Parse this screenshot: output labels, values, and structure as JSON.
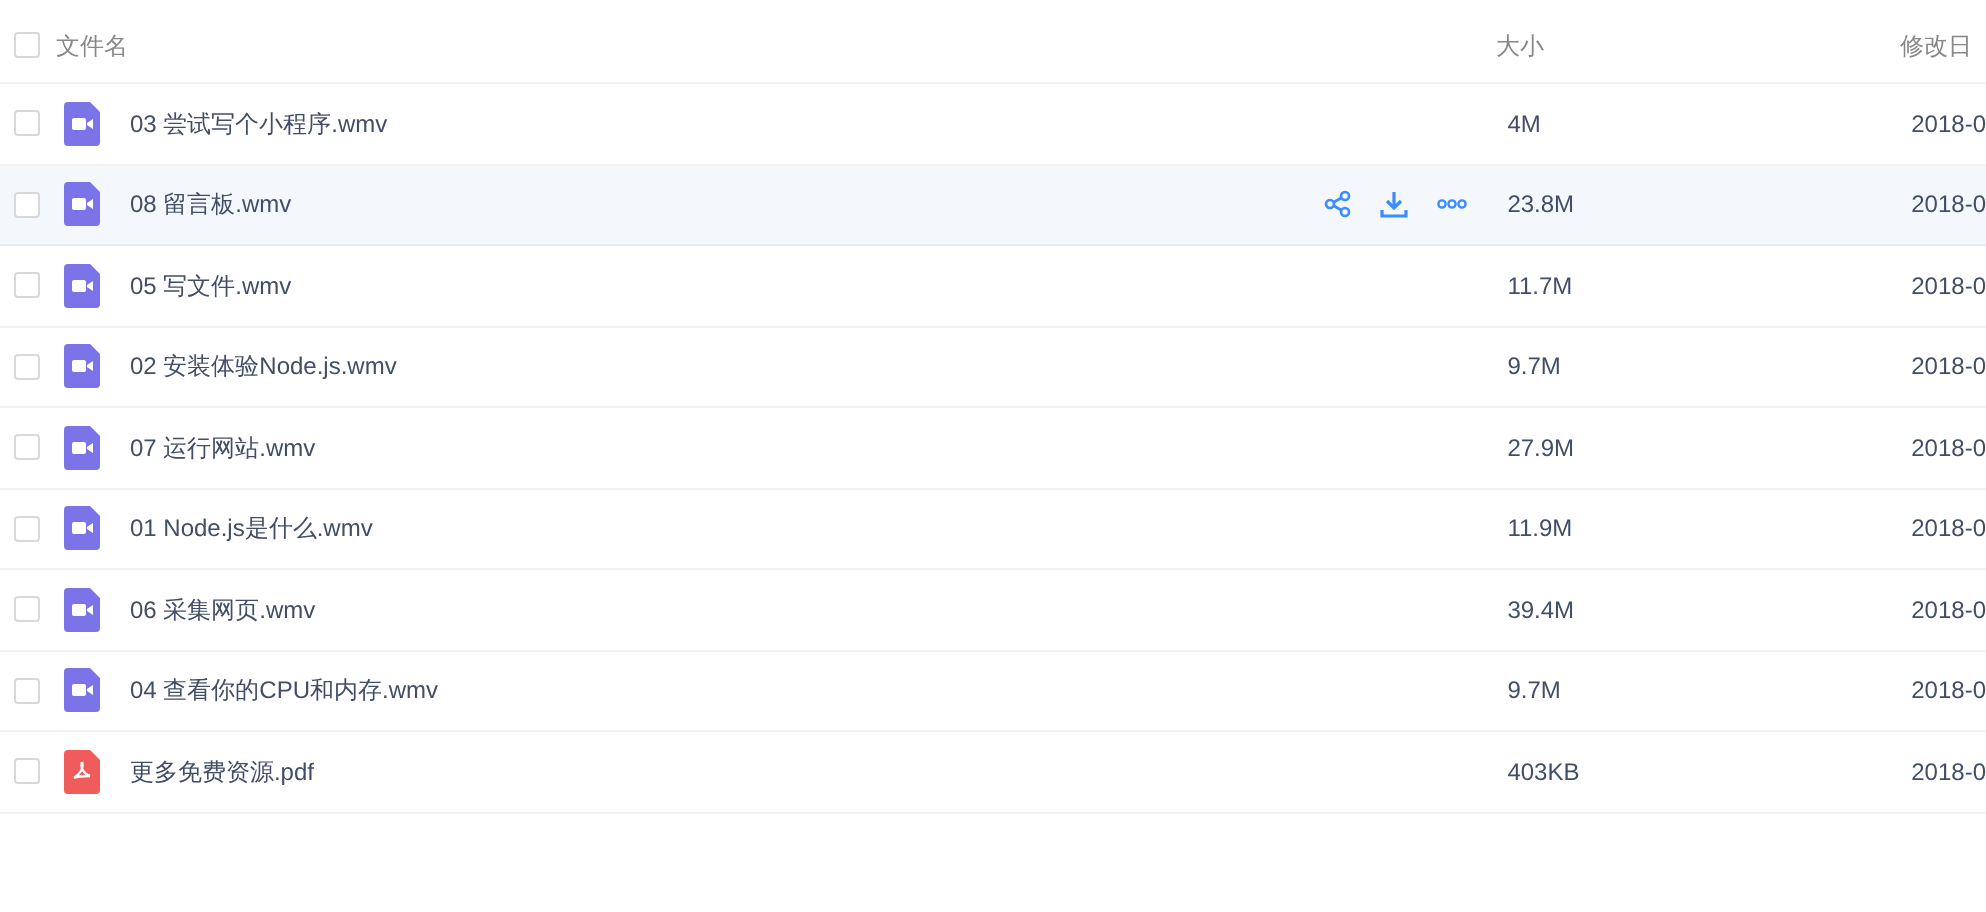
{
  "columns": {
    "name": "文件名",
    "size": "大小",
    "modified": "修改日"
  },
  "header_checked": false,
  "files": [
    {
      "kind": "video",
      "name": "03 尝试写个小程序.wmv",
      "size": "4M",
      "modified": "2018-0",
      "checked": false,
      "highlighted": false
    },
    {
      "kind": "video",
      "name": "08 留言板.wmv",
      "size": "23.8M",
      "modified": "2018-0",
      "checked": false,
      "highlighted": true
    },
    {
      "kind": "video",
      "name": "05 写文件.wmv",
      "size": "11.7M",
      "modified": "2018-0",
      "checked": false,
      "highlighted": false
    },
    {
      "kind": "video",
      "name": "02 安装体验Node.js.wmv",
      "size": "9.7M",
      "modified": "2018-0",
      "checked": false,
      "highlighted": false
    },
    {
      "kind": "video",
      "name": "07 运行网站.wmv",
      "size": "27.9M",
      "modified": "2018-0",
      "checked": false,
      "highlighted": false
    },
    {
      "kind": "video",
      "name": "01 Node.js是什么.wmv",
      "size": "11.9M",
      "modified": "2018-0",
      "checked": false,
      "highlighted": false
    },
    {
      "kind": "video",
      "name": "06 采集网页.wmv",
      "size": "39.4M",
      "modified": "2018-0",
      "checked": false,
      "highlighted": false
    },
    {
      "kind": "video",
      "name": "04 查看你的CPU和内存.wmv",
      "size": "9.7M",
      "modified": "2018-0",
      "checked": false,
      "highlighted": false
    },
    {
      "kind": "pdf",
      "name": "更多免费资源.pdf",
      "size": "403KB",
      "modified": "2018-0",
      "checked": false,
      "highlighted": false
    }
  ]
}
